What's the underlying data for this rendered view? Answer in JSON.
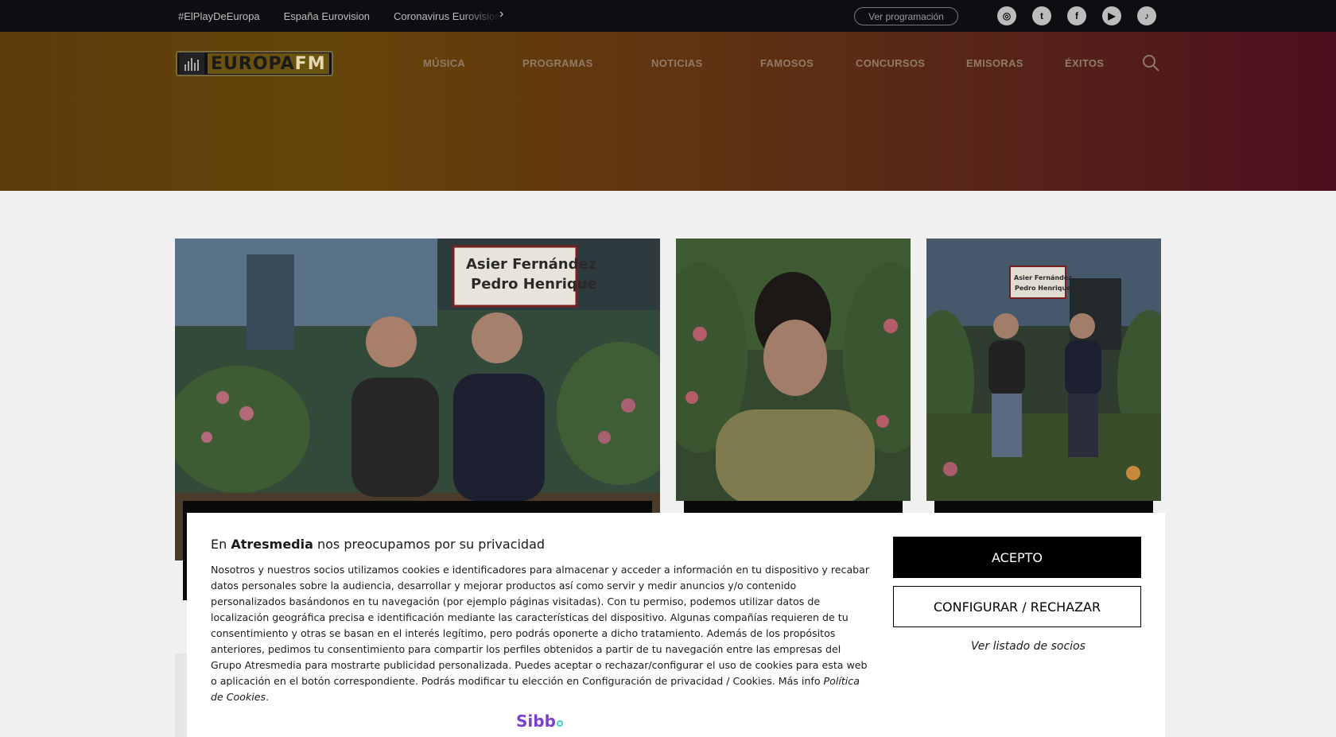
{
  "topbar": {
    "links": [
      "#ElPlayDeEuropa",
      "España Eurovision",
      "Coronavirus Eurovision"
    ],
    "schedule_button": "Ver programación",
    "social": [
      {
        "name": "instagram-icon",
        "glyph": "◎"
      },
      {
        "name": "twitter-icon",
        "glyph": "t"
      },
      {
        "name": "facebook-icon",
        "glyph": "f"
      },
      {
        "name": "youtube-icon",
        "glyph": "▶"
      },
      {
        "name": "tiktok-icon",
        "glyph": "♪"
      }
    ]
  },
  "header": {
    "logo": {
      "europa": "EUROPA",
      "fm": "FM"
    },
    "nav": [
      "MÚSICA",
      "PROGRAMAS",
      "NOTICIAS",
      "FAMOSOS",
      "CONCURSOS",
      "EMISORAS",
      "ÉXITOS"
    ]
  },
  "cards": [
    {
      "image_text": "Asier Fernández\nPedro Henrique"
    },
    {},
    {
      "image_text": "Asier Fernández\nPedro Henrique"
    }
  ],
  "consent": {
    "title_prefix": "En",
    "title_brand": "Atresmedia",
    "title_suffix": "nos preocupamos por su privacidad",
    "body": "Nosotros y nuestros socios utilizamos cookies e identificadores para almacenar y acceder a información en tu dispositivo y recabar datos personales sobre la audiencia, desarrollar y mejorar productos así como servir y medir anuncios y/o contenido personalizados basándonos en tu navegación (por ejemplo páginas visitadas). Con tu permiso, podemos utilizar datos de localización geográfica precisa e identificación mediante las características del dispositivo. Algunas compañías requieren de tu consentimiento y otras se basan en el interés legítimo, pero podrás oponerte a dicho tratamiento. Además de los propósitos anteriores, pedimos tu consentimiento para compartir los perfiles obtenidos a partir de tu navegación entre las empresas del Grupo Atresmedia para mostrarte publicidad personalizada. Puedes aceptar o rechazar/configurar el uso de cookies para esta web o aplicación en el botón correspondiente. Podrás modificar tu elección en Configuración de privacidad / Cookies. Más info",
    "policy_link": "Política de Cookies",
    "policy_suffix": ".",
    "accept": "ACEPTO",
    "configure": "CONFIGURAR / RECHAZAR",
    "partners": "Ver listado de socios",
    "provider": "Sibbo"
  }
}
